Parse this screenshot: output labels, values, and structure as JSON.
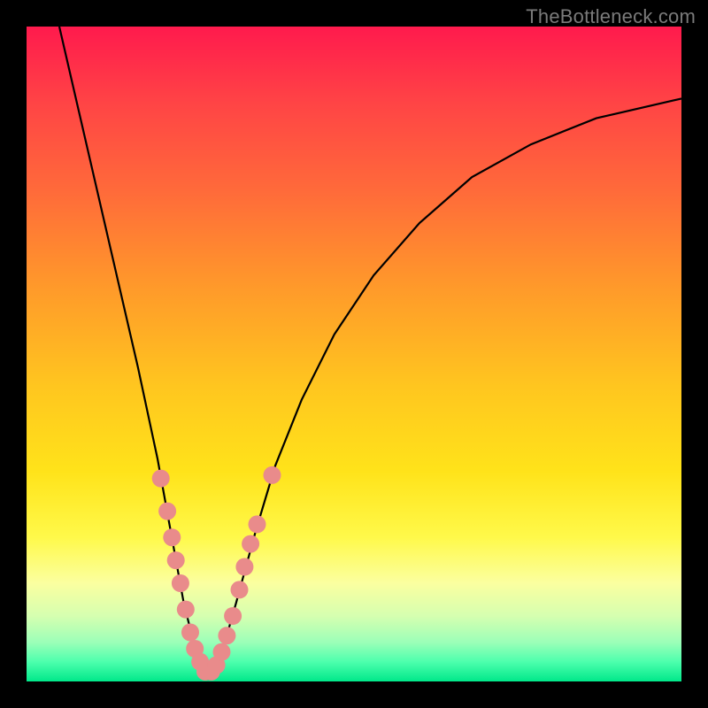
{
  "watermark": "TheBottleneck.com",
  "chart_data": {
    "type": "line",
    "title": "",
    "xlabel": "",
    "ylabel": "",
    "xlim": [
      0,
      100
    ],
    "ylim": [
      0,
      100
    ],
    "curve": {
      "description": "V-shaped bottleneck curve with minimum near x≈27",
      "points": [
        {
          "x": 5.0,
          "y": 100.0
        },
        {
          "x": 8.0,
          "y": 87.0
        },
        {
          "x": 11.0,
          "y": 74.0
        },
        {
          "x": 14.0,
          "y": 61.0
        },
        {
          "x": 17.0,
          "y": 48.0
        },
        {
          "x": 20.0,
          "y": 34.0
        },
        {
          "x": 22.0,
          "y": 23.0
        },
        {
          "x": 24.0,
          "y": 12.0
        },
        {
          "x": 26.0,
          "y": 4.0
        },
        {
          "x": 27.0,
          "y": 1.0
        },
        {
          "x": 28.0,
          "y": 1.0
        },
        {
          "x": 30.0,
          "y": 5.0
        },
        {
          "x": 32.0,
          "y": 12.0
        },
        {
          "x": 35.0,
          "y": 23.0
        },
        {
          "x": 38.0,
          "y": 33.0
        },
        {
          "x": 42.0,
          "y": 43.0
        },
        {
          "x": 47.0,
          "y": 53.0
        },
        {
          "x": 53.0,
          "y": 62.0
        },
        {
          "x": 60.0,
          "y": 70.0
        },
        {
          "x": 68.0,
          "y": 77.0
        },
        {
          "x": 77.0,
          "y": 82.0
        },
        {
          "x": 87.0,
          "y": 86.0
        },
        {
          "x": 100.0,
          "y": 89.0
        }
      ]
    },
    "markers": {
      "description": "Highlighted sample points clustered near the V minimum",
      "radius": 10,
      "points": [
        {
          "x": 20.5,
          "y": 31.0
        },
        {
          "x": 21.5,
          "y": 26.0
        },
        {
          "x": 22.2,
          "y": 22.0
        },
        {
          "x": 22.8,
          "y": 18.5
        },
        {
          "x": 23.5,
          "y": 15.0
        },
        {
          "x": 24.3,
          "y": 11.0
        },
        {
          "x": 25.0,
          "y": 7.5
        },
        {
          "x": 25.7,
          "y": 5.0
        },
        {
          "x": 26.5,
          "y": 3.0
        },
        {
          "x": 27.3,
          "y": 1.5
        },
        {
          "x": 28.2,
          "y": 1.5
        },
        {
          "x": 29.0,
          "y": 2.5
        },
        {
          "x": 29.8,
          "y": 4.5
        },
        {
          "x": 30.6,
          "y": 7.0
        },
        {
          "x": 31.5,
          "y": 10.0
        },
        {
          "x": 32.5,
          "y": 14.0
        },
        {
          "x": 33.3,
          "y": 17.5
        },
        {
          "x": 34.2,
          "y": 21.0
        },
        {
          "x": 35.2,
          "y": 24.0
        },
        {
          "x": 37.5,
          "y": 31.5
        }
      ]
    }
  },
  "colors": {
    "curve": "#000000",
    "marker": "#e98b8b",
    "frame": "#000000"
  }
}
